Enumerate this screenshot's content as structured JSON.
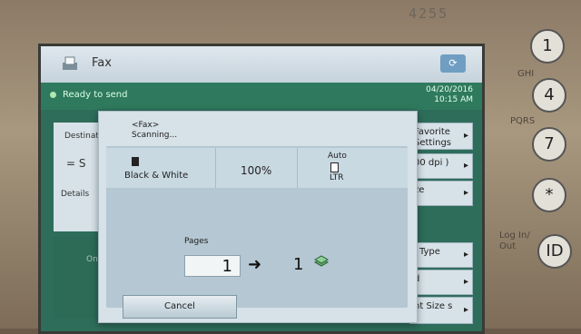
{
  "device": {
    "model": "4255"
  },
  "screen": {
    "title": "Fax",
    "status": "Ready to send",
    "date": "04/20/2016",
    "time": "10:15 AM",
    "left_panel": {
      "destination_label": "Destinatio",
      "dest_value": "= S",
      "details_label": "Details"
    },
    "lower_left_text": "One-T the",
    "right_buttons": [
      {
        "label": "Favorite Settings"
      },
      {
        "label": "00 dpi )"
      },
      {
        "label": "ze"
      },
      {
        "label": "l Type"
      },
      {
        "label": "d"
      },
      {
        "label": "nt Size s"
      }
    ]
  },
  "dialog": {
    "header_line1": "<Fax>",
    "header_line2": "Scanning...",
    "color_mode": "Black & White",
    "zoom": "100%",
    "paper_mode": "Auto",
    "paper_size": "LTR",
    "pages_label": "Pages",
    "scanned_pages": "1",
    "total_pages": "1",
    "cancel_label": "Cancel"
  },
  "keypad": {
    "keys": [
      "1",
      "4",
      "7",
      "*",
      "ID"
    ],
    "labels": [
      "GHI",
      "PQRS",
      "Log In/ Out"
    ]
  }
}
